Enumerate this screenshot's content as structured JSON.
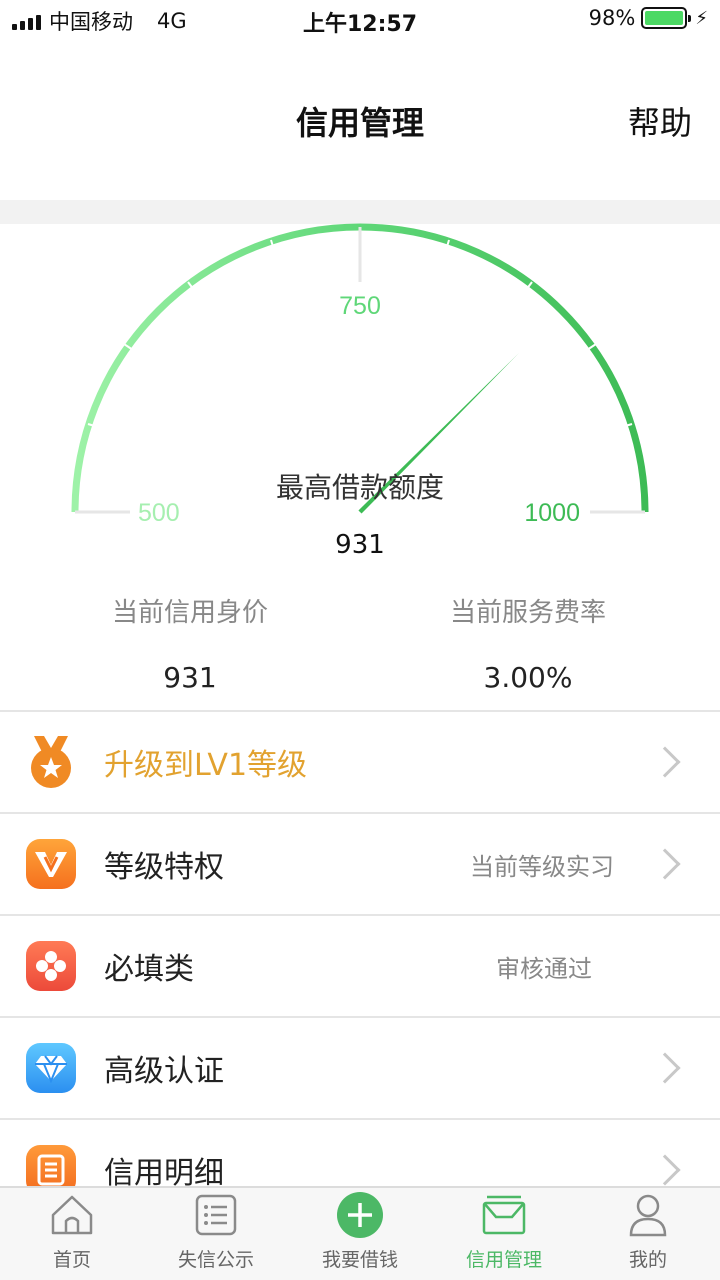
{
  "status_bar": {
    "carrier": "中国移动",
    "network": "4G",
    "time": "上午12:57",
    "battery": "98%"
  },
  "nav": {
    "title": "信用管理",
    "help": "帮助"
  },
  "gauge": {
    "ticks": [
      "500",
      "750",
      "1000"
    ],
    "caption": "最高借款额度",
    "value": "931",
    "min": 500,
    "max": 1000,
    "needle_value": 931
  },
  "stats": {
    "credit_worth_label": "当前信用身价",
    "credit_worth_value": "931",
    "fee_rate_label": "当前服务费率",
    "fee_rate_value": "3.00%"
  },
  "list": {
    "items": [
      {
        "label": "升级到LV1等级",
        "status": "",
        "chevron": true,
        "icon": "medal-icon"
      },
      {
        "label": "等级特权",
        "status": "当前等级实习",
        "chevron": true,
        "icon": "vip-v-icon"
      },
      {
        "label": "必填类",
        "status": "审核通过",
        "chevron": false,
        "icon": "clover-icon"
      },
      {
        "label": "高级认证",
        "status": "",
        "chevron": true,
        "icon": "diamond-icon"
      },
      {
        "label": "信用明细",
        "status": "",
        "chevron": true,
        "icon": "document-icon"
      }
    ]
  },
  "tabbar": {
    "tabs": [
      {
        "label": "首页",
        "icon": "home-icon"
      },
      {
        "label": "失信公示",
        "icon": "list-icon"
      },
      {
        "label": "我要借钱",
        "icon": "plus-circle-icon"
      },
      {
        "label": "信用管理",
        "icon": "inbox-icon",
        "active": true
      },
      {
        "label": "我的",
        "icon": "user-icon"
      }
    ]
  },
  "colors": {
    "accent_green": "#4cb866",
    "gold": "#e2a22f"
  }
}
